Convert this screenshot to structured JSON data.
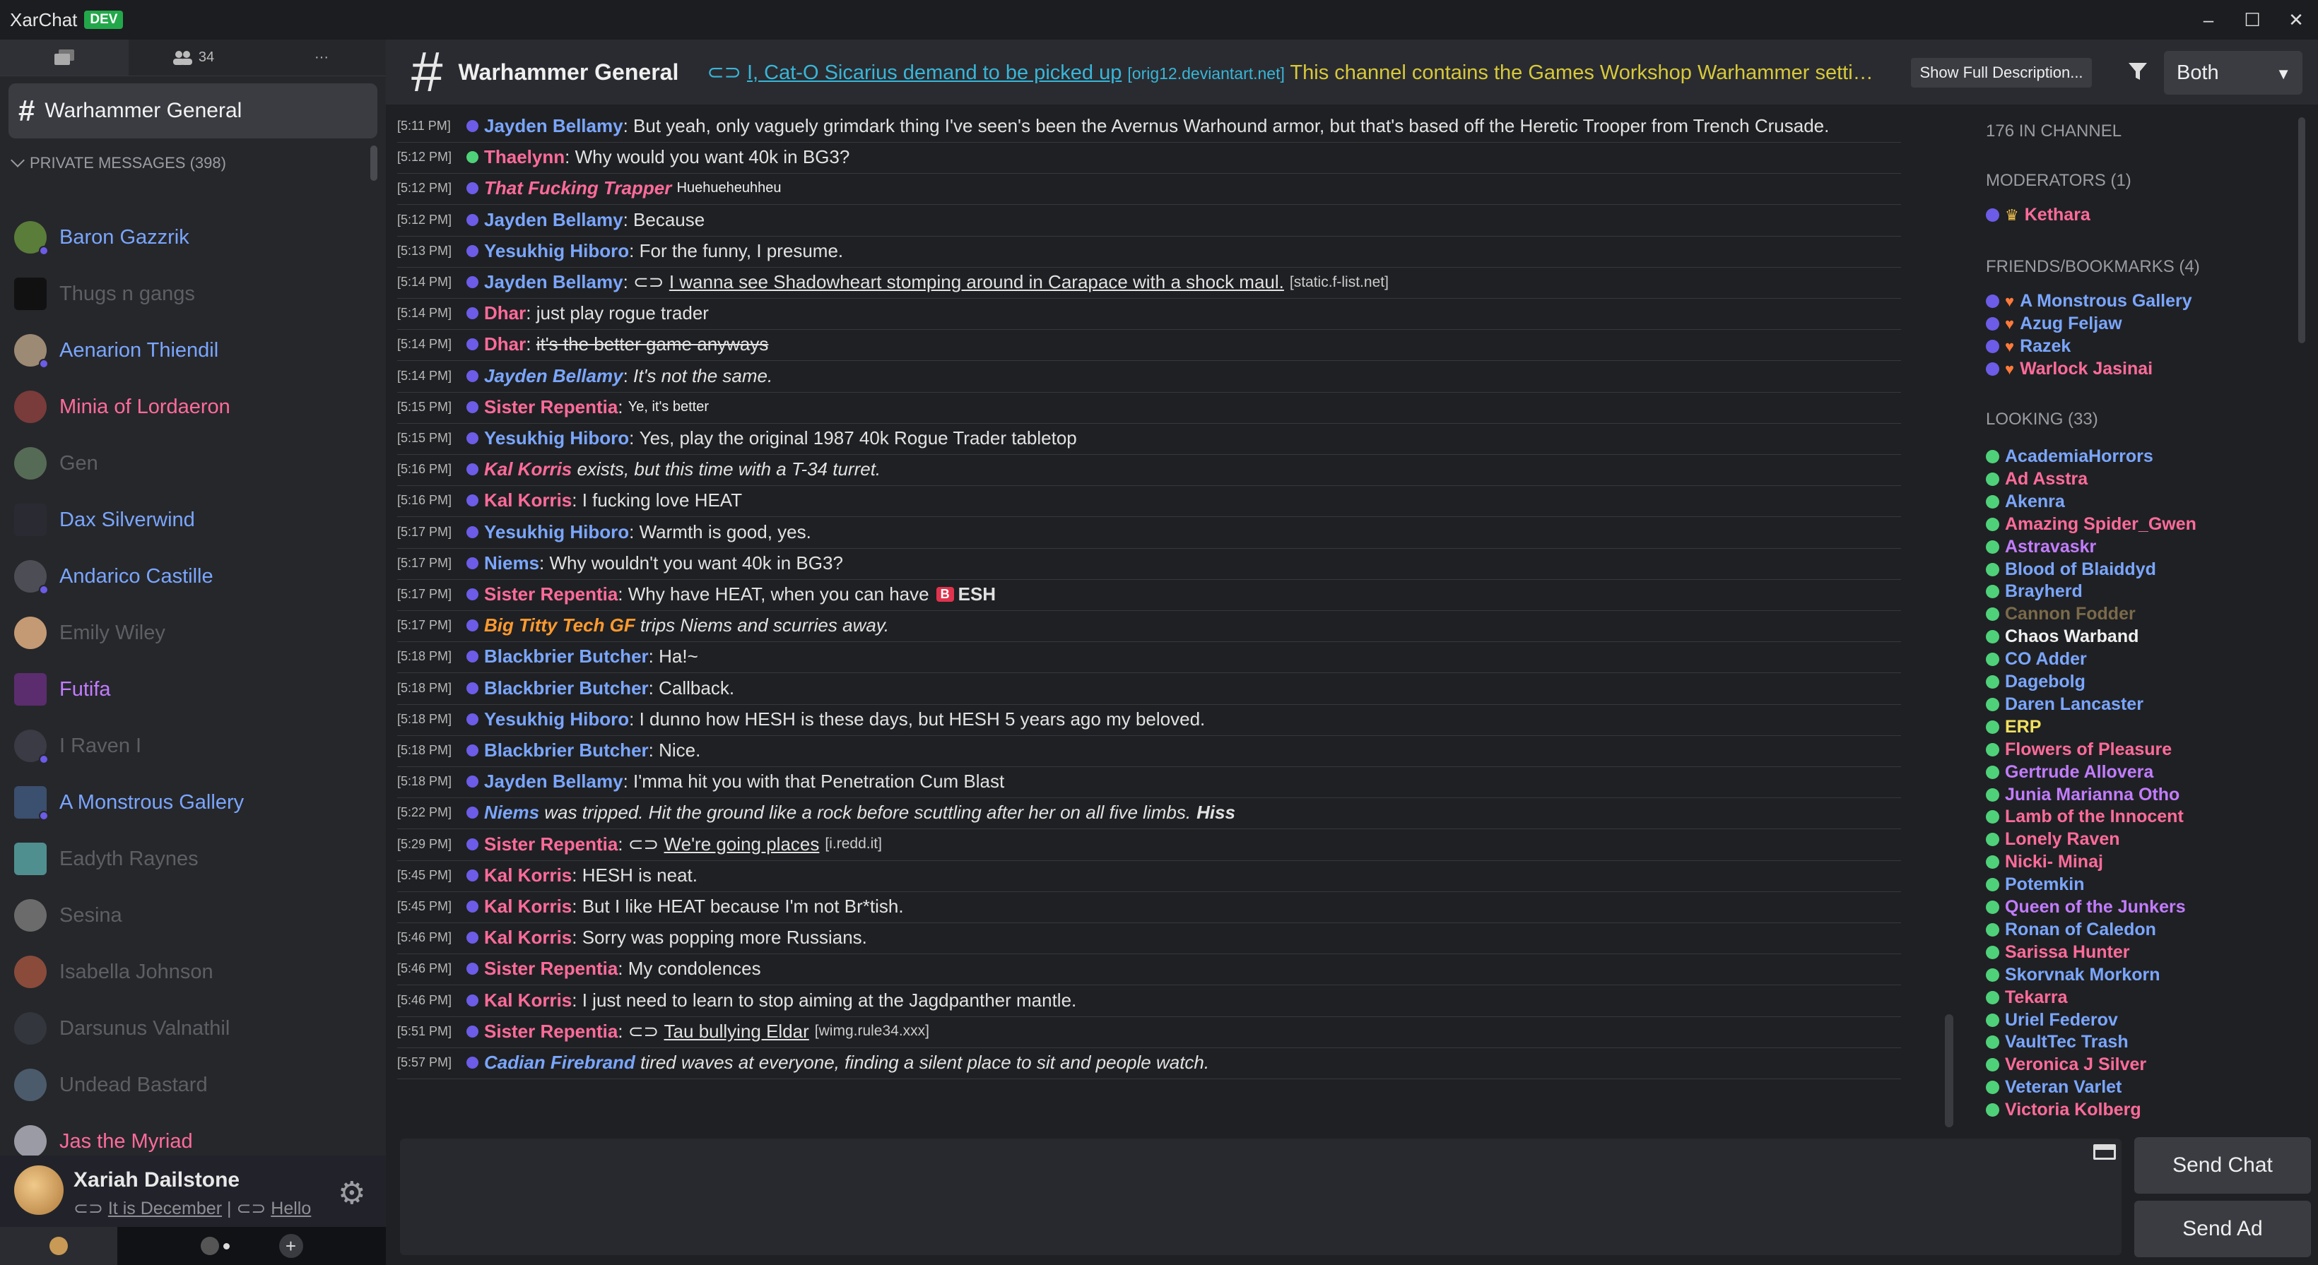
{
  "app": {
    "title": "XarChat",
    "badge": "DEV"
  },
  "window_controls": {
    "minimize": "–",
    "maximize": "☐",
    "close": "✕"
  },
  "left_tabs": {
    "friends_count": "34",
    "more": "···"
  },
  "current_channel": {
    "hash": "#",
    "name": "Warhammer General"
  },
  "pm_header": "PRIVATE MESSAGES (398)",
  "pms": [
    {
      "name": "Baron Gazzrik",
      "color": "#7aa6ff",
      "avatar": "#5a7d3a",
      "online": true
    },
    {
      "name": "Thugs n gangs",
      "color": "#5d5f64",
      "avatar": "#111111",
      "online": false,
      "square": true
    },
    {
      "name": "Aenarion Thiendil",
      "color": "#7aa6ff",
      "avatar": "#9d8a74",
      "online": true
    },
    {
      "name": "Minia of Lordaeron",
      "color": "#ff6b9a",
      "avatar": "#7a3b3b",
      "online": false
    },
    {
      "name": "Gen",
      "color": "#5d5f64",
      "avatar": "#556b55",
      "online": false
    },
    {
      "name": "Dax Silverwind",
      "color": "#7aa6ff",
      "avatar": "#2a2a33",
      "online": false,
      "square": true
    },
    {
      "name": "Andarico Castille",
      "color": "#7aa6ff",
      "avatar": "#4d4d55",
      "online": true
    },
    {
      "name": "Emily Wiley",
      "color": "#5d5f64",
      "avatar": "#c49a74",
      "online": false
    },
    {
      "name": "Futifa",
      "color": "#c27cff",
      "avatar": "#5b2d6e",
      "online": false,
      "square": true
    },
    {
      "name": "I Raven I",
      "color": "#5d5f64",
      "avatar": "#3b3b45",
      "online": true
    },
    {
      "name": "A Monstrous Gallery",
      "color": "#7aa6ff",
      "avatar": "#3b4f6e",
      "online": true,
      "square": true
    },
    {
      "name": "Eadyth Raynes",
      "color": "#5d5f64",
      "avatar": "#4f8f8f",
      "online": false,
      "square": true
    },
    {
      "name": "Sesina",
      "color": "#5d5f64",
      "avatar": "#6b6b6b",
      "online": false
    },
    {
      "name": "Isabella Johnson",
      "color": "#5d5f64",
      "avatar": "#8a4b3b",
      "online": false
    },
    {
      "name": "Darsunus Valnathil",
      "color": "#5d5f64",
      "avatar": "#33363d",
      "online": false
    },
    {
      "name": "Undead Bastard",
      "color": "#5d5f64",
      "avatar": "#4b5b6b",
      "online": false
    },
    {
      "name": "Jas the Myriad",
      "color": "#ff6b9a",
      "avatar": "#9b9ba6",
      "online": false
    }
  ],
  "me": {
    "name": "Xariah Dailstone",
    "status_link1": "It is December",
    "sep": "|",
    "status_link2": "Hello",
    "add": "+"
  },
  "header": {
    "title": "Warhammer General",
    "desc_link": "I, Cat-O Sicarius demand to be picked up",
    "desc_domain": "[orig12.deviantart.net]",
    "desc_text": "This channel contains the Games Workshop Warhammer setting and all related discussions.",
    "show_desc": "Show Full Description...",
    "mode": "Both"
  },
  "messages": [
    {
      "ts": "[5:11 PM]",
      "name": "Jayden Bellamy",
      "color": "#7aa6ff",
      "dot": "#6c5ce7",
      "sep": ": ",
      "text": "But yeah, only vaguely grimdark thing I've seen's been the Avernus Warhound armor, but that's based off the Heretic Trooper from Trench Crusade."
    },
    {
      "ts": "[5:12 PM]",
      "name": "Thaelynn",
      "color": "#ff6b9a",
      "dot": "#4fd17a",
      "sep": ": ",
      "text": "Why would you want 40k in BG3?"
    },
    {
      "ts": "[5:12 PM]",
      "name": "That Fucking Trapper",
      "color": "#ff6b9a",
      "dot": "#6c5ce7",
      "sep": " ",
      "small": "Huehueheuhheu",
      "italicname": true
    },
    {
      "ts": "[5:12 PM]",
      "name": "Jayden Bellamy",
      "color": "#7aa6ff",
      "dot": "#6c5ce7",
      "sep": ": ",
      "text": "Because"
    },
    {
      "ts": "[5:13 PM]",
      "name": "Yesukhig Hiboro",
      "color": "#7aa6ff",
      "dot": "#6c5ce7",
      "sep": ": ",
      "text": "For the funny, I presume."
    },
    {
      "ts": "[5:14 PM]",
      "name": "Jayden Bellamy",
      "color": "#7aa6ff",
      "dot": "#6c5ce7",
      "sep": ": ",
      "link": "I wanna see Shadowheart stomping around in Carapace with a shock maul.",
      "domain": "[static.f-list.net]"
    },
    {
      "ts": "[5:14 PM]",
      "name": "Dhar",
      "color": "#ff6b9a",
      "dot": "#6c5ce7",
      "sep": ": ",
      "text": "just play rogue trader"
    },
    {
      "ts": "[5:14 PM]",
      "name": "Dhar",
      "color": "#ff6b9a",
      "dot": "#6c5ce7",
      "sep": ": ",
      "strike": "it's the better game anyways"
    },
    {
      "ts": "[5:14 PM]",
      "name": "Jayden Bellamy",
      "color": "#7aa6ff",
      "dot": "#6c5ce7",
      "sep": ": ",
      "text": "It's not the same.",
      "italic": true
    },
    {
      "ts": "[5:15 PM]",
      "name": "Sister Repentia",
      "color": "#ff6b9a",
      "dot": "#6c5ce7",
      "sep": ": ",
      "small": "Ye, it's better"
    },
    {
      "ts": "[5:15 PM]",
      "name": "Yesukhig Hiboro",
      "color": "#7aa6ff",
      "dot": "#6c5ce7",
      "sep": ": ",
      "text": "Yes, play the original 1987 40k Rogue Trader tabletop"
    },
    {
      "ts": "[5:16 PM]",
      "name": "Kal Korris",
      "color": "#ff6b9a",
      "dot": "#6c5ce7",
      "sep": " ",
      "text": "exists, but this time with a T-34 turret.",
      "emote": true
    },
    {
      "ts": "[5:16 PM]",
      "name": "Kal Korris",
      "color": "#ff6b9a",
      "dot": "#6c5ce7",
      "sep": ": ",
      "text": "I fucking love HEAT"
    },
    {
      "ts": "[5:17 PM]",
      "name": "Yesukhig Hiboro",
      "color": "#7aa6ff",
      "dot": "#6c5ce7",
      "sep": ": ",
      "text": "Warmth is good, yes."
    },
    {
      "ts": "[5:17 PM]",
      "name": "Niems",
      "color": "#7aa6ff",
      "dot": "#6c5ce7",
      "sep": ": ",
      "text": "Why wouldn't you want 40k in BG3?"
    },
    {
      "ts": "[5:17 PM]",
      "name": "Sister Repentia",
      "color": "#ff6b9a",
      "dot": "#6c5ce7",
      "sep": ": ",
      "text": "Why have HEAT, when you can have",
      "badge": "B",
      "after": "ESH"
    },
    {
      "ts": "[5:17 PM]",
      "name": "Big Titty Tech GF",
      "color": "#ff9a2e",
      "dot": "#6c5ce7",
      "sep": " ",
      "text": "trips Niems and scurries away.",
      "emote": true
    },
    {
      "ts": "[5:18 PM]",
      "name": "Blackbrier Butcher",
      "color": "#7aa6ff",
      "dot": "#6c5ce7",
      "sep": ": ",
      "text": "Ha!~"
    },
    {
      "ts": "[5:18 PM]",
      "name": "Blackbrier Butcher",
      "color": "#7aa6ff",
      "dot": "#6c5ce7",
      "sep": ": ",
      "text": "Callback."
    },
    {
      "ts": "[5:18 PM]",
      "name": "Yesukhig Hiboro",
      "color": "#7aa6ff",
      "dot": "#6c5ce7",
      "sep": ": ",
      "text": "I dunno how HESH is these days, but HESH 5 years ago my beloved."
    },
    {
      "ts": "[5:18 PM]",
      "name": "Blackbrier Butcher",
      "color": "#7aa6ff",
      "dot": "#6c5ce7",
      "sep": ": ",
      "text": "Nice."
    },
    {
      "ts": "[5:18 PM]",
      "name": "Jayden Bellamy",
      "color": "#7aa6ff",
      "dot": "#6c5ce7",
      "sep": ": ",
      "text": "I'mma hit you with that Penetration Cum Blast"
    },
    {
      "ts": "[5:22 PM]",
      "name": "Niems",
      "color": "#7aa6ff",
      "dot": "#6c5ce7",
      "sep": " ",
      "text": "was tripped. Hit the ground like a rock before scuttling after her on all five limbs.",
      "emote": true,
      "bold_tail": "Hiss"
    },
    {
      "ts": "[5:29 PM]",
      "name": "Sister Repentia",
      "color": "#ff6b9a",
      "dot": "#6c5ce7",
      "sep": ": ",
      "link": "We're going places",
      "domain": "[i.redd.it]"
    },
    {
      "ts": "[5:45 PM]",
      "name": "Kal Korris",
      "color": "#ff6b9a",
      "dot": "#6c5ce7",
      "sep": ": ",
      "text": "HESH is neat."
    },
    {
      "ts": "[5:45 PM]",
      "name": "Kal Korris",
      "color": "#ff6b9a",
      "dot": "#6c5ce7",
      "sep": ": ",
      "text": "But I like HEAT because I'm not Br*tish."
    },
    {
      "ts": "[5:46 PM]",
      "name": "Kal Korris",
      "color": "#ff6b9a",
      "dot": "#6c5ce7",
      "sep": ": ",
      "text": "Sorry was popping more Russians."
    },
    {
      "ts": "[5:46 PM]",
      "name": "Sister Repentia",
      "color": "#ff6b9a",
      "dot": "#6c5ce7",
      "sep": ": ",
      "text": "My condolences"
    },
    {
      "ts": "[5:46 PM]",
      "name": "Kal Korris",
      "color": "#ff6b9a",
      "dot": "#6c5ce7",
      "sep": ": ",
      "text": "I just need to learn to stop aiming at the Jagdpanther mantle."
    },
    {
      "ts": "[5:51 PM]",
      "name": "Sister Repentia",
      "color": "#ff6b9a",
      "dot": "#6c5ce7",
      "sep": ": ",
      "link": "Tau bullying Eldar",
      "domain": "[wimg.rule34.xxx]"
    },
    {
      "ts": "[5:57 PM]",
      "name": "Cadian Firebrand",
      "color": "#7aa6ff",
      "dot": "#6c5ce7",
      "sep": " ",
      "text": "tired waves at everyone, finding a silent place to sit and people watch.",
      "emote": true
    }
  ],
  "members": {
    "in_channel": "176 IN CHANNEL",
    "moderators_header": "MODERATORS (1)",
    "moderators": [
      {
        "name": "Kethara",
        "color": "#ff6b9a",
        "dot": "#6c5ce7",
        "icon": "♛"
      }
    ],
    "friends_header": "FRIENDS/BOOKMARKS (4)",
    "friends": [
      {
        "name": "A Monstrous Gallery",
        "color": "#7aa6ff",
        "dot": "#6c5ce7",
        "icon": "♥"
      },
      {
        "name": "Azug Feljaw",
        "color": "#7aa6ff",
        "dot": "#6c5ce7",
        "icon": "♥"
      },
      {
        "name": "Razek",
        "color": "#7aa6ff",
        "dot": "#6c5ce7",
        "icon": "♥"
      },
      {
        "name": "Warlock Jasinai",
        "color": "#ff6b9a",
        "dot": "#6c5ce7",
        "icon": "♥"
      }
    ],
    "looking_header": "LOOKING (33)",
    "looking": [
      {
        "name": "AcademiaHorrors",
        "color": "#7aa6ff"
      },
      {
        "name": "Ad Asstra",
        "color": "#ff6b9a"
      },
      {
        "name": "Akenra",
        "color": "#7aa6ff"
      },
      {
        "name": "Amazing Spider_Gwen",
        "color": "#ff6b9a"
      },
      {
        "name": "Astravaskr",
        "color": "#c27cff"
      },
      {
        "name": "Blood of Blaiddyd",
        "color": "#7aa6ff"
      },
      {
        "name": "Brayherd",
        "color": "#7aa6ff"
      },
      {
        "name": "Cannon Fodder",
        "color": "#7a6a4a"
      },
      {
        "name": "Chaos Warband",
        "color": "#f0f0f0"
      },
      {
        "name": "CO Adder",
        "color": "#7aa6ff"
      },
      {
        "name": "Dagebolg",
        "color": "#7aa6ff"
      },
      {
        "name": "Daren Lancaster",
        "color": "#7aa6ff"
      },
      {
        "name": "ERP",
        "color": "#f0e060"
      },
      {
        "name": "Flowers of Pleasure",
        "color": "#ff6b9a"
      },
      {
        "name": "Gertrude Allovera",
        "color": "#c27cff"
      },
      {
        "name": "Junia Marianna Otho",
        "color": "#c27cff"
      },
      {
        "name": "Lamb of the Innocent",
        "color": "#ff6b9a"
      },
      {
        "name": "Lonely Raven",
        "color": "#ff6b9a"
      },
      {
        "name": "Nicki- Minaj",
        "color": "#ff6b9a"
      },
      {
        "name": "Potemkin",
        "color": "#7aa6ff"
      },
      {
        "name": "Queen of the Junkers",
        "color": "#c27cff"
      },
      {
        "name": "Ronan of Caledon",
        "color": "#7aa6ff"
      },
      {
        "name": "Sarissa Hunter",
        "color": "#ff6b9a"
      },
      {
        "name": "Skorvnak Morkorn",
        "color": "#7aa6ff"
      },
      {
        "name": "Tekarra",
        "color": "#ff6b9a"
      },
      {
        "name": "Uriel Federov",
        "color": "#7aa6ff"
      },
      {
        "name": "VaultTec Trash",
        "color": "#7aa6ff"
      },
      {
        "name": "Veronica J Silver",
        "color": "#ff6b9a"
      },
      {
        "name": "Veteran Varlet",
        "color": "#7aa6ff"
      },
      {
        "name": "Victoria Kolberg",
        "color": "#ff6b9a"
      }
    ]
  },
  "buttons": {
    "send_chat": "Send Chat",
    "send_ad": "Send Ad"
  },
  "colors": {
    "looking_dot": "#4fd17a",
    "away_dot": "#6c5ce7",
    "accent": "#38b6d8"
  }
}
